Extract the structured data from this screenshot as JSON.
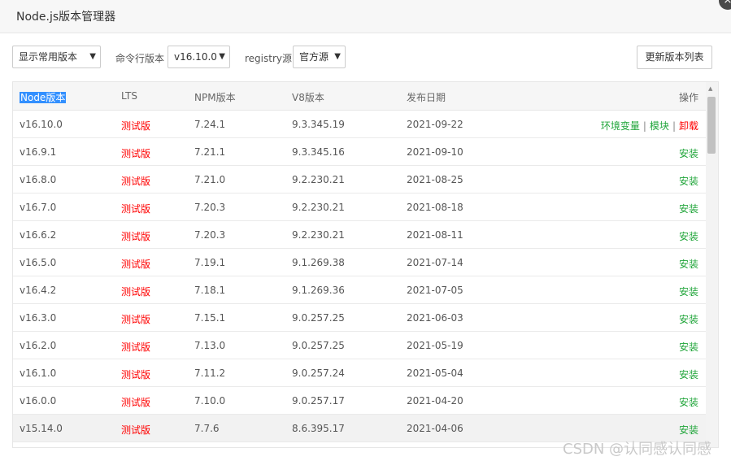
{
  "window": {
    "title": "Node.js版本管理器",
    "close_symbol": "×"
  },
  "toolbar": {
    "show_filter": "显示常用版本",
    "cli_label": "命令行版本",
    "cli_version": "v16.10.0",
    "registry_label": "registry源",
    "registry_value": "官方源",
    "refresh_label": "更新版本列表",
    "dropdown_arrow": "▼"
  },
  "table": {
    "headers": {
      "node": "Node版本",
      "lts": "LTS",
      "npm": "NPM版本",
      "v8": "V8版本",
      "date": "发布日期",
      "ops": "操作"
    },
    "rows": [
      {
        "node": "v16.10.0",
        "lts": "测试版",
        "npm": "7.24.1",
        "v8": "9.3.345.19",
        "date": "2021-09-22"
      },
      {
        "node": "v16.9.1",
        "lts": "测试版",
        "npm": "7.21.1",
        "v8": "9.3.345.16",
        "date": "2021-09-10",
        "action": "安装"
      },
      {
        "node": "v16.8.0",
        "lts": "测试版",
        "npm": "7.21.0",
        "v8": "9.2.230.21",
        "date": "2021-08-25",
        "action": "安装"
      },
      {
        "node": "v16.7.0",
        "lts": "测试版",
        "npm": "7.20.3",
        "v8": "9.2.230.21",
        "date": "2021-08-18",
        "action": "安装"
      },
      {
        "node": "v16.6.2",
        "lts": "测试版",
        "npm": "7.20.3",
        "v8": "9.2.230.21",
        "date": "2021-08-11",
        "action": "安装"
      },
      {
        "node": "v16.5.0",
        "lts": "测试版",
        "npm": "7.19.1",
        "v8": "9.1.269.38",
        "date": "2021-07-14",
        "action": "安装"
      },
      {
        "node": "v16.4.2",
        "lts": "测试版",
        "npm": "7.18.1",
        "v8": "9.1.269.36",
        "date": "2021-07-05",
        "action": "安装"
      },
      {
        "node": "v16.3.0",
        "lts": "测试版",
        "npm": "7.15.1",
        "v8": "9.0.257.25",
        "date": "2021-06-03",
        "action": "安装"
      },
      {
        "node": "v16.2.0",
        "lts": "测试版",
        "npm": "7.13.0",
        "v8": "9.0.257.25",
        "date": "2021-05-19",
        "action": "安装"
      },
      {
        "node": "v16.1.0",
        "lts": "测试版",
        "npm": "7.11.2",
        "v8": "9.0.257.24",
        "date": "2021-05-04",
        "action": "安装"
      },
      {
        "node": "v16.0.0",
        "lts": "测试版",
        "npm": "7.10.0",
        "v8": "9.0.257.17",
        "date": "2021-04-20",
        "action": "安装"
      },
      {
        "node": "v15.14.0",
        "lts": "测试版",
        "npm": "7.7.6",
        "v8": "8.6.395.17",
        "date": "2021-04-06",
        "action": "安装"
      }
    ],
    "first_row_ops": {
      "env": "环境变量",
      "modules": "模块",
      "uninstall": "卸载",
      "separator": "|"
    }
  },
  "scroll_up_symbol": "▲",
  "watermark": "CSDN @认同感认同感",
  "colors": {
    "lts_red": "#ff0000",
    "action_green": "#20a53a",
    "selection_blue": "#3390ff"
  }
}
